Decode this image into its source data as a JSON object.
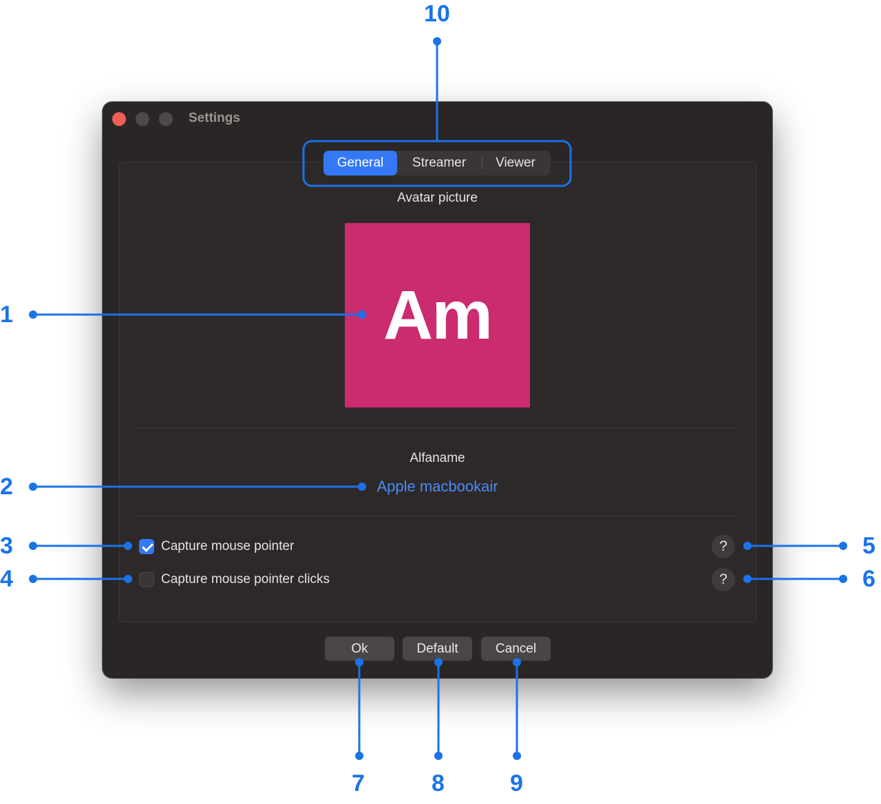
{
  "window": {
    "title": "Settings"
  },
  "tabs": [
    {
      "label": "General",
      "active": true
    },
    {
      "label": "Streamer",
      "active": false
    },
    {
      "label": "Viewer",
      "active": false
    }
  ],
  "avatar": {
    "section_label": "Avatar picture",
    "initials": "Am",
    "background_color": "#cb2b6f"
  },
  "name": {
    "label": "Alfaname",
    "device_name": "Apple macbookair"
  },
  "options": [
    {
      "label": "Capture mouse pointer",
      "checked": true,
      "help": "?"
    },
    {
      "label": "Capture mouse pointer clicks",
      "checked": false,
      "help": "?"
    }
  ],
  "buttons": {
    "ok": "Ok",
    "default": "Default",
    "cancel": "Cancel"
  },
  "callouts": {
    "n1": "1",
    "n2": "2",
    "n3": "3",
    "n4": "4",
    "n5": "5",
    "n6": "6",
    "n7": "7",
    "n8": "8",
    "n9": "9",
    "n10": "10",
    "color": "#1a73e8"
  },
  "colors": {
    "accent": "#3478f6",
    "link": "#4a8cf7",
    "window_bg": "#2a2625",
    "close_button": "#ee5e57"
  }
}
